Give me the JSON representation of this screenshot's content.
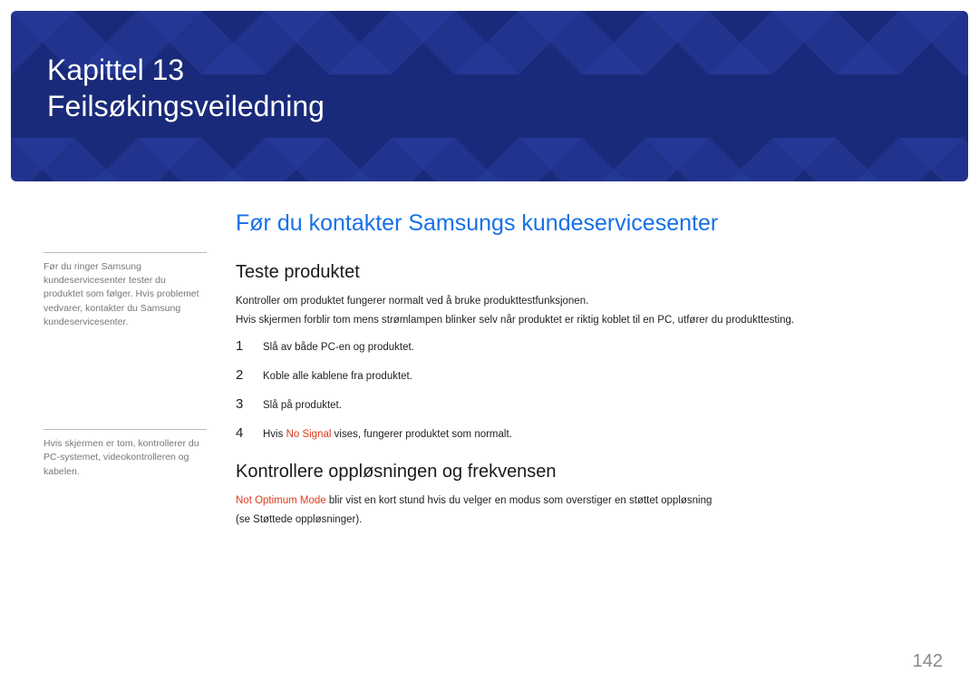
{
  "hero": {
    "line1": "Kapittel 13",
    "line2": "Feilsøkingsveiledning"
  },
  "sidebar": {
    "note1": "Før du ringer Samsung kundeservicesenter tester du produktet som følger. Hvis problemet vedvarer, kontakter du Samsung kundeservicesenter.",
    "note2": "Hvis skjermen er tom, kontrollerer du PC-systemet, videokontrolleren og kabelen."
  },
  "main": {
    "h1": "Før du kontakter Samsungs kundeservicesenter",
    "section1": {
      "heading": "Teste produktet",
      "p1": "Kontroller om produktet fungerer normalt ved å bruke produkttestfunksjonen.",
      "p2": "Hvis skjermen forblir tom mens strømlampen blinker selv når produktet er riktig koblet til en PC, utfører du produkttesting.",
      "steps": [
        {
          "num": "1",
          "text": "Slå av både PC-en og produktet."
        },
        {
          "num": "2",
          "text": "Koble alle kablene fra produktet."
        },
        {
          "num": "3",
          "text": "Slå på produktet."
        },
        {
          "num": "4",
          "prefix": "Hvis ",
          "red": "No Signal",
          "suffix": " vises, fungerer produktet som normalt."
        }
      ]
    },
    "section2": {
      "heading": "Kontrollere oppløsningen og frekvensen",
      "p1_red": "Not Optimum Mode",
      "p1_rest": " blir vist en kort stund hvis du velger en modus som overstiger en støttet oppløsning",
      "p2": "(se Støttede oppløsninger)."
    }
  },
  "page_number": "142"
}
